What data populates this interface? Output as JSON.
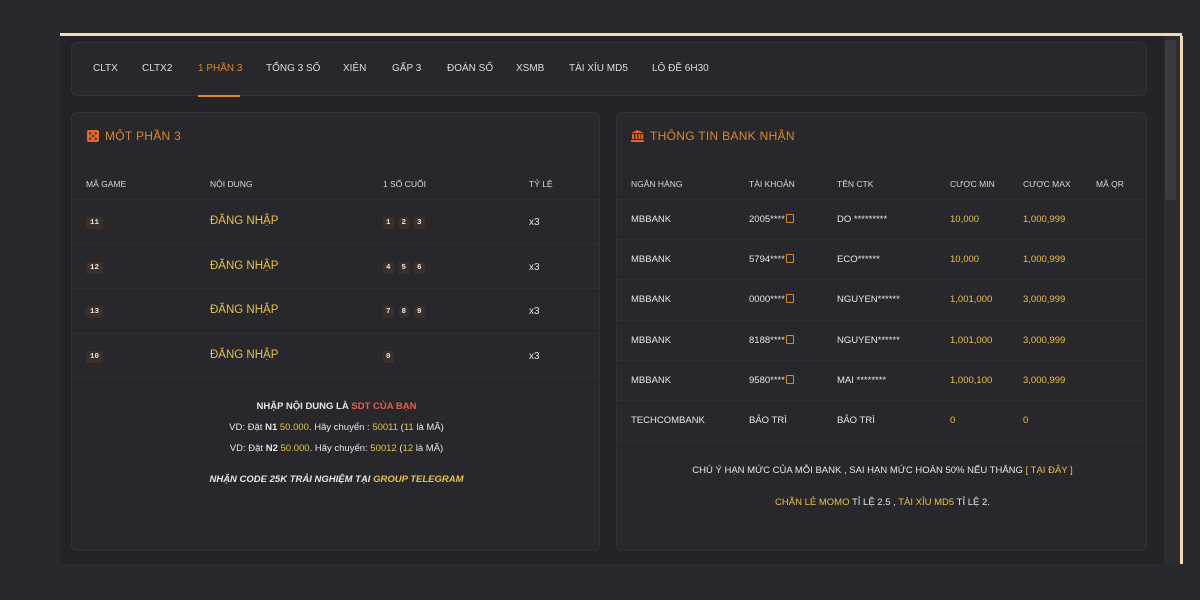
{
  "tabs": [
    {
      "label": "CLTX"
    },
    {
      "label": "CLTX2"
    },
    {
      "label": "1 PHẦN 3"
    },
    {
      "label": "TỔNG 3 SỐ"
    },
    {
      "label": "XIÊN"
    },
    {
      "label": "GẤP 3"
    },
    {
      "label": "ĐOÁN SỐ"
    },
    {
      "label": "XSMB"
    },
    {
      "label": "TÀI XỈU MD5"
    },
    {
      "label": "LÔ ĐỀ 6H30"
    }
  ],
  "active_tab": "1 PHẦN 3",
  "colors": {
    "accent": "#d9882d",
    "gold": "#e8c246",
    "red": "#ec5b4b",
    "background": "#29282d"
  },
  "game_panel": {
    "title": "MỘT PHẦN 3",
    "icon": "dice-icon",
    "headers": {
      "code": "MÃ GAME",
      "content": "NỘI DUNG",
      "last_digit": "1 SỐ CUỐI",
      "rate": "TỶ LỆ"
    },
    "rows": [
      {
        "code": "11",
        "content": "ĐĂNG NHẬP",
        "digits": [
          "1",
          "2",
          "3"
        ],
        "rate": "x3"
      },
      {
        "code": "12",
        "content": "ĐĂNG NHẬP",
        "digits": [
          "4",
          "5",
          "6"
        ],
        "rate": "x3"
      },
      {
        "code": "13",
        "content": "ĐĂNG NHẬP",
        "digits": [
          "7",
          "8",
          "9"
        ],
        "rate": "x3"
      },
      {
        "code": "10",
        "content": "ĐĂNG NHẬP",
        "digits": [
          "0"
        ],
        "rate": "x3"
      }
    ],
    "instructions": {
      "line1_prefix": "NHẬP NỘI DUNG LÀ ",
      "line1_highlight": "SDT CỦA BẠN",
      "ex1_a": "VD: Đặt ",
      "ex1_b": "N1",
      "ex1_c": " ",
      "ex1_amount": "50.000",
      "ex1_d": ". Hãy chuyển : ",
      "ex1_code": "50011",
      "ex1_e": " (",
      "ex1_n": "11",
      "ex1_f": " là MÃ)",
      "ex2_a": "VD: Đặt ",
      "ex2_b": "N2",
      "ex2_c": " ",
      "ex2_amount": "50.000",
      "ex2_d": ". Hãy chuyển: ",
      "ex2_code": "50012",
      "ex2_e": " (",
      "ex2_n": "12",
      "ex2_f": " là MÃ)",
      "promo_prefix": "NHẬN CODE 25K TRẢI NGHIỆM TẠI ",
      "promo_link": "GROUP TELEGRAM"
    }
  },
  "bank_panel": {
    "title": "THÔNG TIN BANK NHẬN",
    "icon": "bank-icon",
    "headers": {
      "bank": "NGÂN HÀNG",
      "account": "TÀI KHOẢN",
      "name": "TÊN CTK",
      "min": "CƯỢC MIN",
      "max": "CƯỢC MAX",
      "qr": "MÃ QR"
    },
    "rows": [
      {
        "bank": "MBBANK",
        "account": "2005****",
        "name": "DO *********",
        "min": "10,000",
        "max": "1,000,999",
        "copy": true
      },
      {
        "bank": "MBBANK",
        "account": "5794****",
        "name": "ECO******",
        "min": "10,000",
        "max": "1,000,999",
        "copy": true
      },
      {
        "bank": "MBBANK",
        "account": "0000****",
        "name": "NGUYEN******",
        "min": "1,001,000",
        "max": "3,000,999",
        "copy": true
      },
      {
        "bank": "MBBANK",
        "account": "8188****",
        "name": "NGUYEN******",
        "min": "1,001,000",
        "max": "3,000,999",
        "copy": true
      },
      {
        "bank": "MBBANK",
        "account": "9580****",
        "name": "MAI ********",
        "min": "1,000,100",
        "max": "3,000,999",
        "copy": true
      },
      {
        "bank": "TECHCOMBANK",
        "account": "BẢO TRÌ",
        "name": "BẢO TRÌ",
        "min": "0",
        "max": "0",
        "copy": false
      }
    ],
    "note_text": "CHÚ Ý HẠN MỨC CỦA MỖI BANK , SAI HẠN MỨC HOÀN 50% NẾU THẮNG ",
    "note_link": "[ TẠI ĐÂY ]",
    "promo_a": "CHẴN LẺ MOMO",
    "promo_b": " TỈ LỆ 2.5 , ",
    "promo_c": "TÀI XỈU MD5",
    "promo_d": " TỈ LỆ 2."
  }
}
